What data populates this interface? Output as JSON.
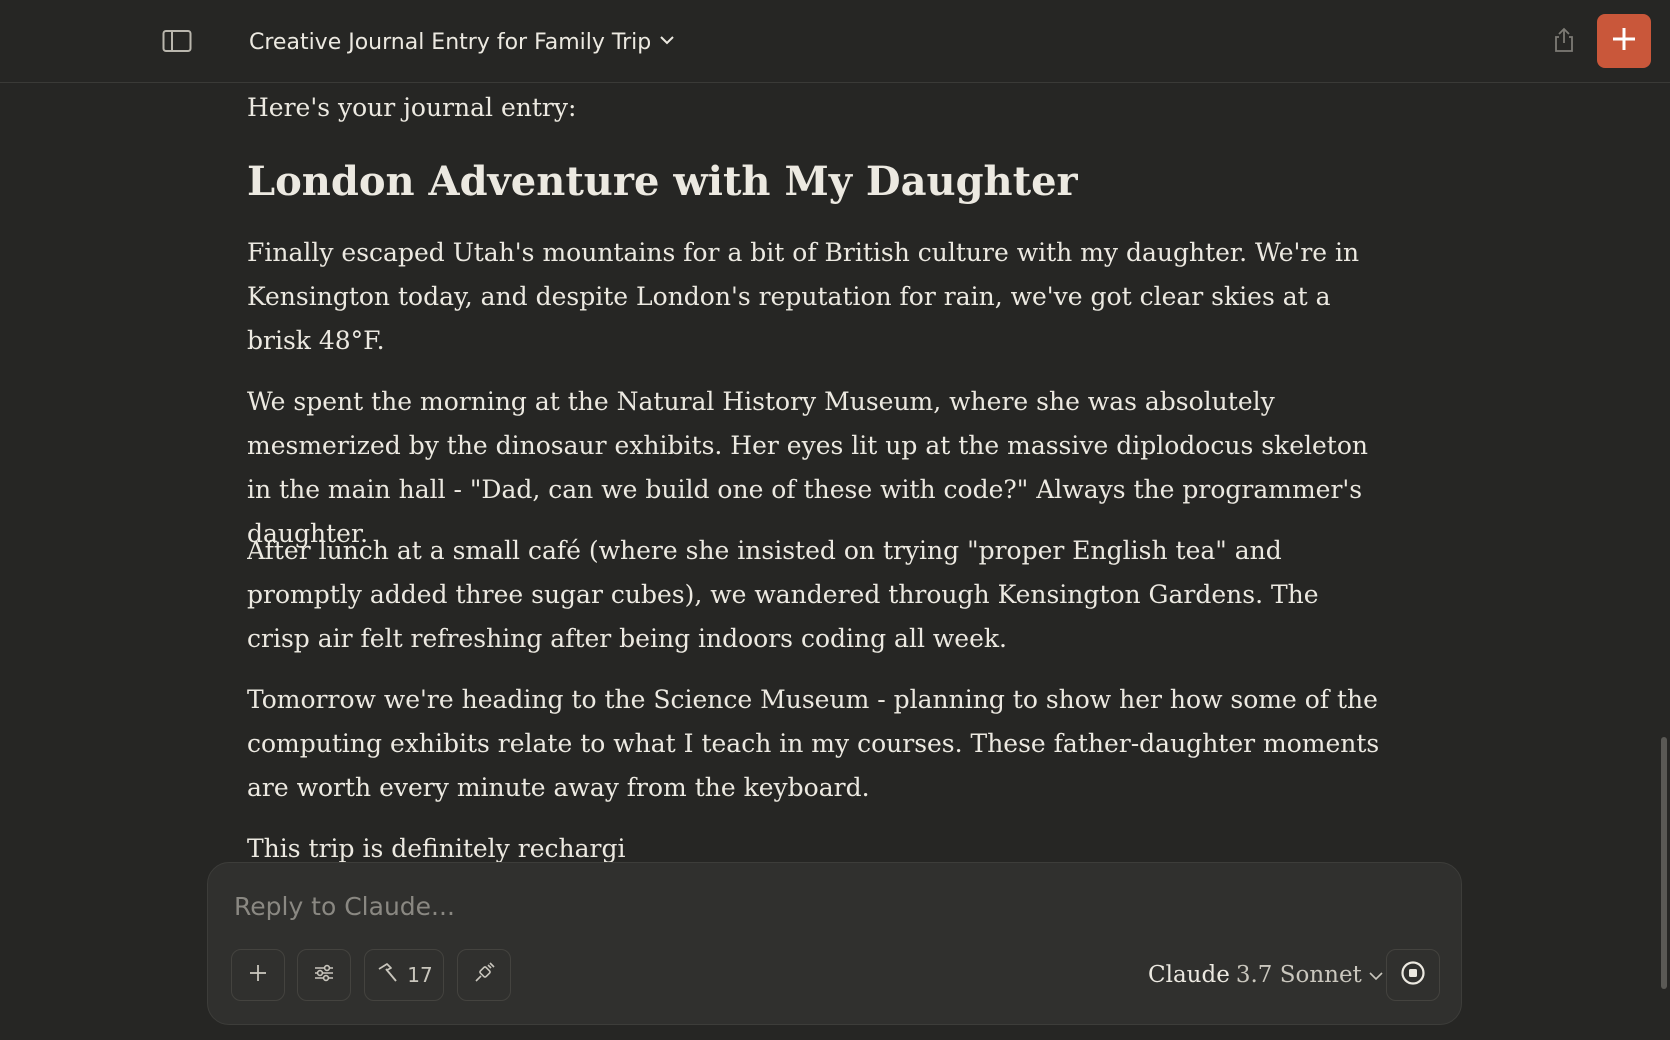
{
  "header": {
    "title": "Creative Journal Entry for Family Trip",
    "icons": {
      "sidebar": "sidebar-toggle-icon",
      "chevron": "chevron-down-icon",
      "share": "share-icon",
      "new_chat": "plus-icon"
    },
    "accent_color": "#c9573a"
  },
  "message": {
    "intro": "Here's your journal entry:",
    "heading": "London Adventure with My Daughter",
    "paragraphs": [
      "Finally escaped Utah's mountains for a bit of British culture with my daughter. We're in Kensington today, and despite London's reputation for rain, we've got clear skies at a brisk 48°F.",
      "We spent the morning at the Natural History Museum, where she was absolutely mesmerized by the dinosaur exhibits. Her eyes lit up at the massive diplodocus skeleton in the main hall - \"Dad, can we build one of these with code?\" Always the programmer's daughter.",
      "After lunch at a small café (where she insisted on trying \"proper English tea\" and promptly added three sugar cubes), we wandered through Kensington Gardens. The crisp air felt refreshing after being indoors coding all week.",
      "Tomorrow we're heading to the Science Museum - planning to show her how some of the computing exhibits relate to what I teach in my courses. These father-daughter moments are worth every minute away from the keyboard.",
      "This trip is definitely rechargi"
    ]
  },
  "composer": {
    "placeholder": "Reply to Claude...",
    "tools_count": "17",
    "model_brand": "Claude",
    "model_version": "3.7 Sonnet",
    "icons": {
      "add": "plus-icon",
      "settings": "sliders-icon",
      "tools": "hammer-icon",
      "extension": "plug-icon",
      "stop": "stop-icon"
    }
  }
}
